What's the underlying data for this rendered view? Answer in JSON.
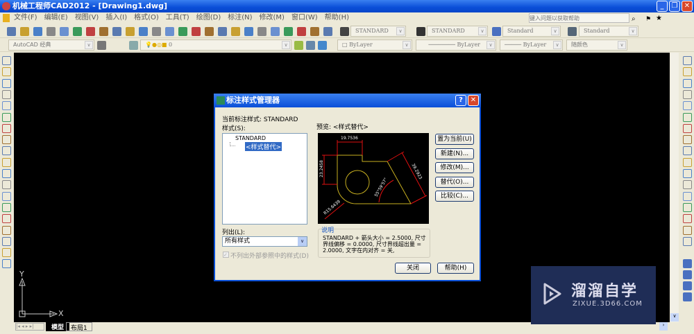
{
  "window": {
    "title": "机械工程师CAD2012 - [Drawing1.dwg]",
    "min": "_",
    "restore": "❐",
    "close": "✕"
  },
  "menu": [
    "文件(F)",
    "编辑(E)",
    "视图(V)",
    "插入(I)",
    "格式(O)",
    "工具(T)",
    "绘图(D)",
    "标注(N)",
    "修改(M)",
    "窗口(W)",
    "帮助(H)"
  ],
  "help_search": {
    "placeholder": "键入问题以获取帮助"
  },
  "toolbar1": {
    "icons": [
      "new-icon",
      "open-icon",
      "save-icon",
      "print-icon",
      "preview-icon",
      "publish-icon",
      "web-icon",
      "cut-icon",
      "copy-icon",
      "paste-icon",
      "match-icon",
      "brush-icon",
      "undo-icon",
      "redo-icon",
      "pan-icon",
      "zoom-realtime-icon",
      "zoom-window-icon",
      "zoom-previous-icon",
      "properties-icon",
      "design-center-icon",
      "tool-palette-icon",
      "sheet-set-icon",
      "markup-icon",
      "calculator-icon",
      "help-icon"
    ],
    "text_style": "STANDARD",
    "dim_style": "STANDARD",
    "table_style": "Standard",
    "multileader_style": "Standard"
  },
  "toolbar2": {
    "workspace": "AutoCAD 经典",
    "layer": "0",
    "color": "ByLayer",
    "linetype": "ByLayer",
    "lineweight": "ByLayer",
    "plotstyle": "随颜色"
  },
  "left_tools": [
    "line-icon",
    "construction-line-icon",
    "polyline-icon",
    "polygon-icon",
    "rectangle-icon",
    "arc-icon",
    "circle-icon",
    "revcloud-icon",
    "spline-icon",
    "ellipse-icon",
    "ellipse-arc-icon",
    "insert-block-icon",
    "make-block-icon",
    "point-icon",
    "hatch-icon",
    "gradient-icon",
    "region-icon",
    "table-icon",
    "mtext-icon"
  ],
  "right_tools": [
    "erase-icon",
    "copy-object-icon",
    "mirror-icon",
    "offset-icon",
    "array-icon",
    "move-icon",
    "rotate-icon",
    "scale-icon",
    "stretch-icon",
    "trim-icon",
    "extend-icon",
    "break-point-icon",
    "break-icon",
    "join-icon",
    "chamfer-icon",
    "fillet-icon",
    "explode-icon"
  ],
  "ucs": {
    "x": "X",
    "y": "Y"
  },
  "tabs": {
    "model": "模型",
    "layout": "布局1"
  },
  "dialog": {
    "title": "标注样式管理器",
    "help": "?",
    "close": "✕",
    "current_label": "当前标注样式: STANDARD",
    "styles_label": "样式(S):",
    "styles": [
      "STANDARD",
      "<样式替代>"
    ],
    "preview_label": "预览: <样式替代>",
    "preview_dims": {
      "top": "19.7536",
      "left": "23.2458",
      "aligned": "39.2923",
      "angle": "55°59'57\"",
      "radius": "R15.6439"
    },
    "list_label": "列出(L):",
    "list_value": "所有样式",
    "checkbox_label": "不列出外部参照中的样式(D)",
    "desc_title": "说明",
    "desc": "STANDARD + 箭头大小 = 2.5000, 尺寸界线偏移 = 0.0000, 尺寸界线超出量 = 2.0000, 文字在内对齐 = 关,",
    "buttons": [
      "置为当前(U)",
      "新建(N)...",
      "修改(M)...",
      "替代(O)...",
      "比较(C)..."
    ],
    "close_button": "关闭",
    "help_button": "帮助(H)"
  },
  "watermark": {
    "name": "溜溜自学",
    "url": "ZIXUE.3D66.COM"
  }
}
